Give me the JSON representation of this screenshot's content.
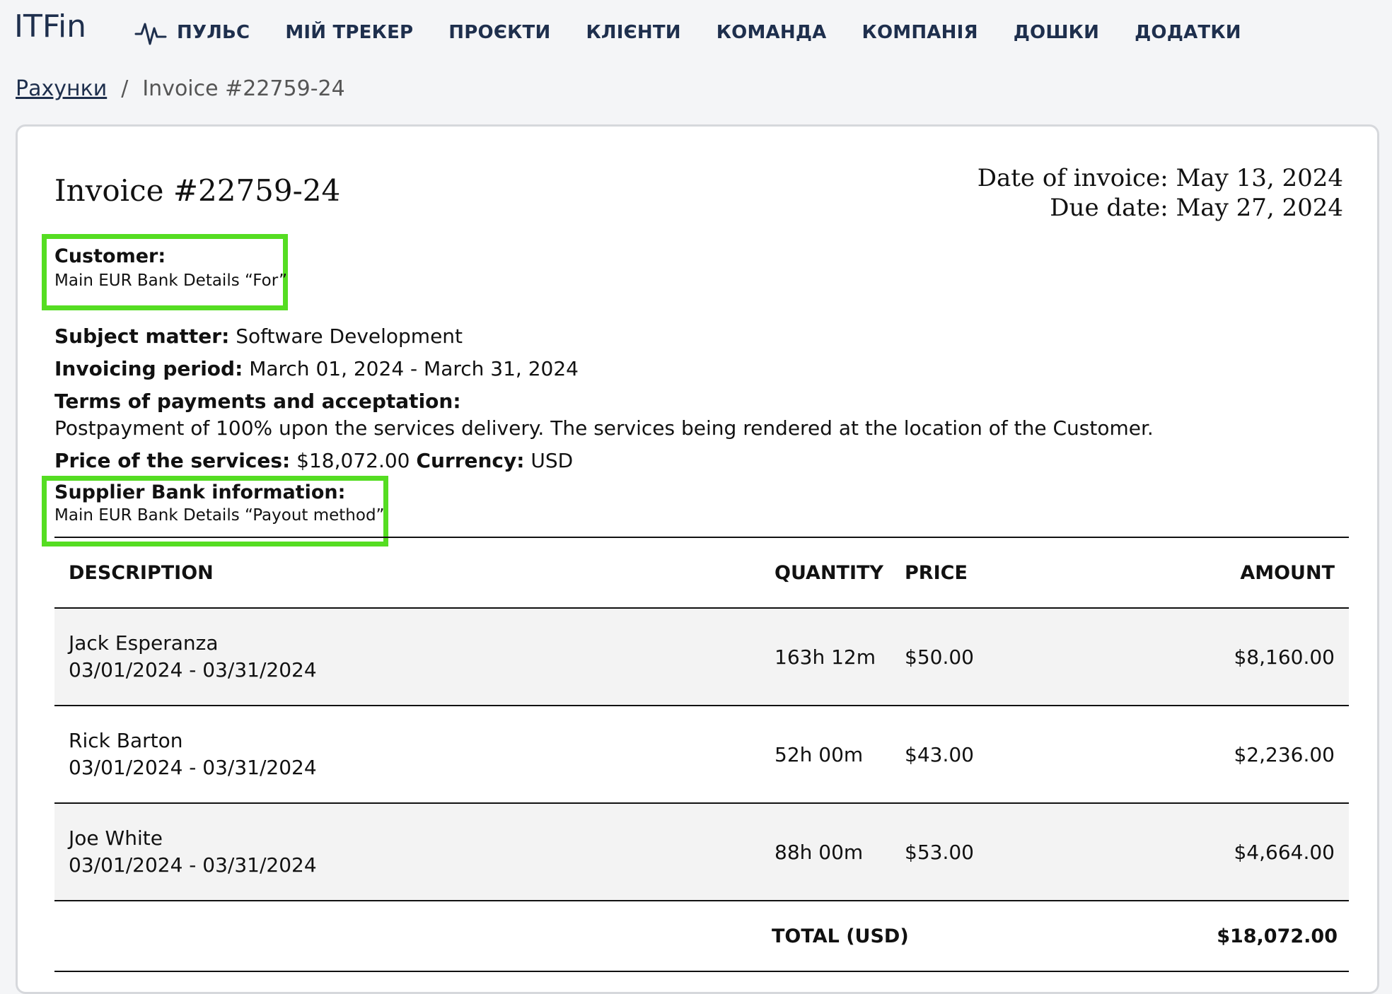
{
  "app": {
    "logo": "ITFin"
  },
  "nav": [
    {
      "label": "ПУЛЬС",
      "icon": "pulse-icon"
    },
    {
      "label": "МІЙ ТРЕКЕР"
    },
    {
      "label": "ПРОЄКТИ"
    },
    {
      "label": "КЛІЄНТИ"
    },
    {
      "label": "КОМАНДА"
    },
    {
      "label": "КОМПАНІЯ"
    },
    {
      "label": "ДОШКИ"
    },
    {
      "label": "ДОДАТКИ"
    }
  ],
  "breadcrumb": {
    "parent": "Рахунки",
    "separator": "/",
    "current": "Invoice #22759-24"
  },
  "invoice": {
    "title": "Invoice #22759-24",
    "date_of_invoice_label": "Date of invoice:",
    "date_of_invoice": "May 13, 2024",
    "due_date_label": "Due date:",
    "due_date": "May 27, 2024",
    "customer_label": "Customer:",
    "customer_value": "Main EUR Bank Details “For”",
    "subject_label": "Subject matter:",
    "subject_value": "Software Development",
    "period_label": "Invoicing period:",
    "period_value": "March 01, 2024 - March 31, 2024",
    "terms_label": "Terms of payments and acceptation:",
    "terms_value": "Postpayment of 100% upon the services delivery. The services being rendered at the location of the Customer.",
    "price_label": "Price of the services:",
    "price_value": "$18,072.00",
    "currency_label": "Currency:",
    "currency_value": "USD",
    "supplier_label": "Supplier Bank information:",
    "supplier_value": "Main EUR Bank Details “Payout method”"
  },
  "table": {
    "headers": {
      "description": "DESCRIPTION",
      "quantity": "QUANTITY",
      "price": "PRICE",
      "amount": "AMOUNT"
    },
    "rows": [
      {
        "name": "Jack Esperanza",
        "period": "03/01/2024 - 03/31/2024",
        "quantity": "163h 12m",
        "price": "$50.00",
        "amount": "$8,160.00"
      },
      {
        "name": "Rick Barton",
        "period": "03/01/2024 - 03/31/2024",
        "quantity": "52h 00m",
        "price": "$43.00",
        "amount": "$2,236.00"
      },
      {
        "name": "Joe White",
        "period": "03/01/2024 - 03/31/2024",
        "quantity": "88h 00m",
        "price": "$53.00",
        "amount": "$4,664.00"
      }
    ],
    "total_label": "TOTAL (USD)",
    "total_value": "$18,072.00"
  },
  "colors": {
    "nav_text": "#1e2f4d",
    "highlight": "#55dd22",
    "row_shade": "#f3f3f3"
  }
}
